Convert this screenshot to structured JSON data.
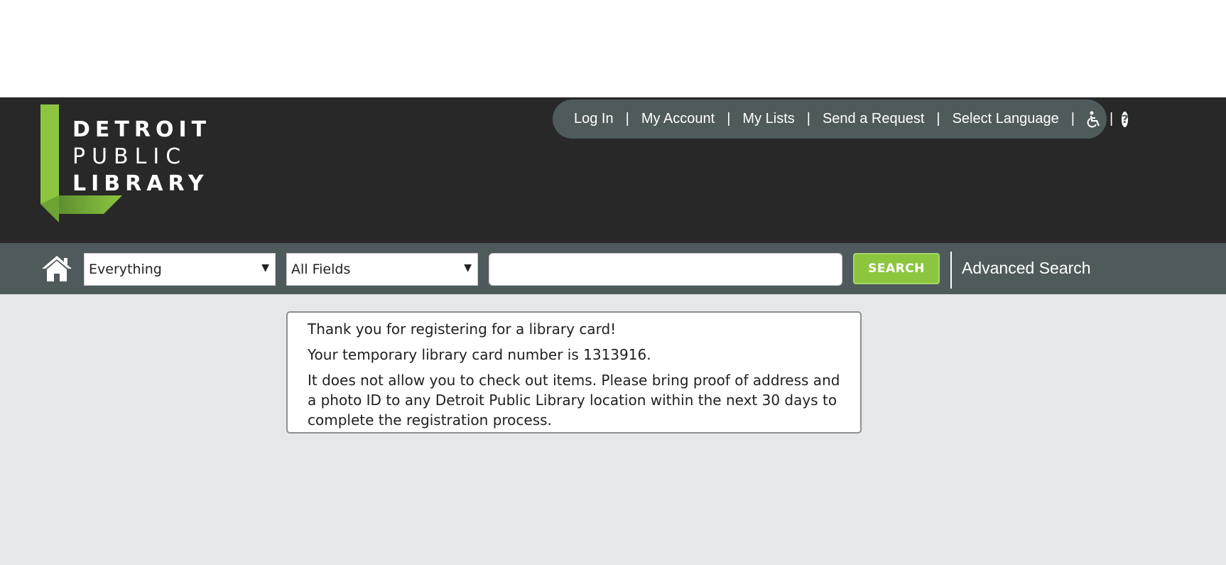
{
  "logo": {
    "line1": "DETROIT",
    "line2": "PUBLIC",
    "line3": "LIBRARY",
    "accent_color": "#8cc63f"
  },
  "topnav": {
    "items": [
      {
        "label": "Log In"
      },
      {
        "label": "My Account"
      },
      {
        "label": "My Lists"
      },
      {
        "label": "Send a Request"
      },
      {
        "label": "Select Language"
      }
    ],
    "separator": "|",
    "accessibility_icon": "wheelchair-icon",
    "help_icon": "help-icon",
    "help_glyph": "?"
  },
  "search": {
    "home_icon": "home-icon",
    "scope_selected": "Everything",
    "field_selected": "All Fields",
    "query_value": "",
    "button_label": "SEARCH",
    "advanced_label": "Advanced Search",
    "button_color": "#8cc63f"
  },
  "message": {
    "line1": "Thank you for registering for a library card!",
    "line2": "Your temporary library card number is 1313916.",
    "line3": "It does not allow you to check out items. Please bring proof of address and a photo ID to any Detroit Public Library location within the next 30 days to complete the registration process."
  },
  "colors": {
    "header_bg": "#282828",
    "nav_pill_bg": "#4f5a5c",
    "searchbar_bg": "#4f5a5c",
    "content_bg": "#e4e8e9"
  }
}
